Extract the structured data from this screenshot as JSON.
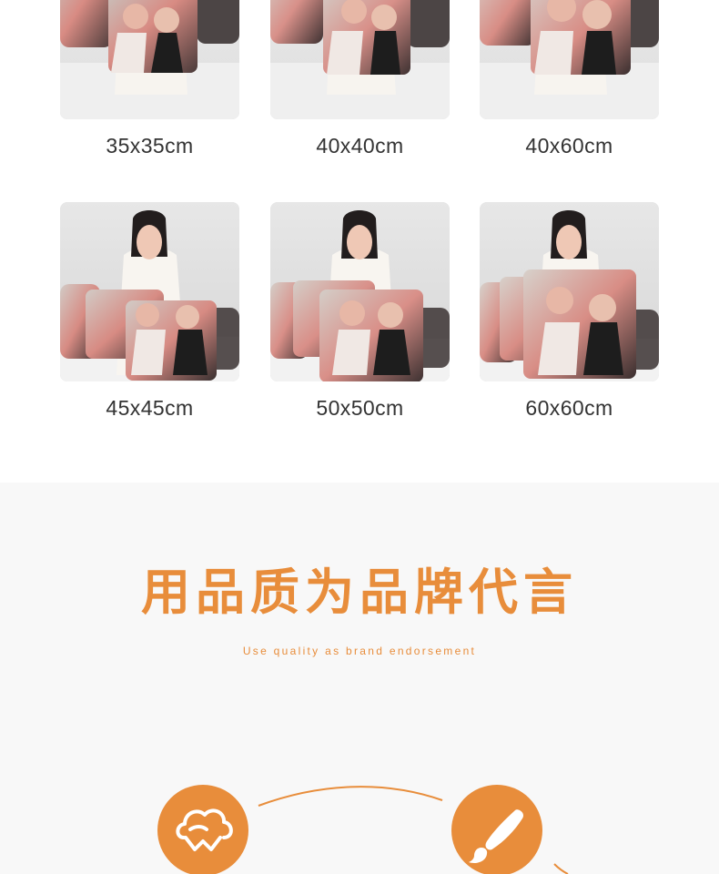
{
  "products": [
    {
      "size": "35x35cm"
    },
    {
      "size": "40x40cm"
    },
    {
      "size": "40x60cm"
    },
    {
      "size": "45x45cm"
    },
    {
      "size": "50x50cm"
    },
    {
      "size": "60x60cm"
    }
  ],
  "quality": {
    "title": "用品质为品牌代言",
    "subtitle": "Use quality as brand endorsement"
  },
  "theme": {
    "accent": "#e88d3b",
    "section_background": "#f8f8f8",
    "text_dark": "#333333"
  },
  "icons": {
    "left": "cotton-cloud-icon",
    "right": "paintbrush-icon"
  }
}
